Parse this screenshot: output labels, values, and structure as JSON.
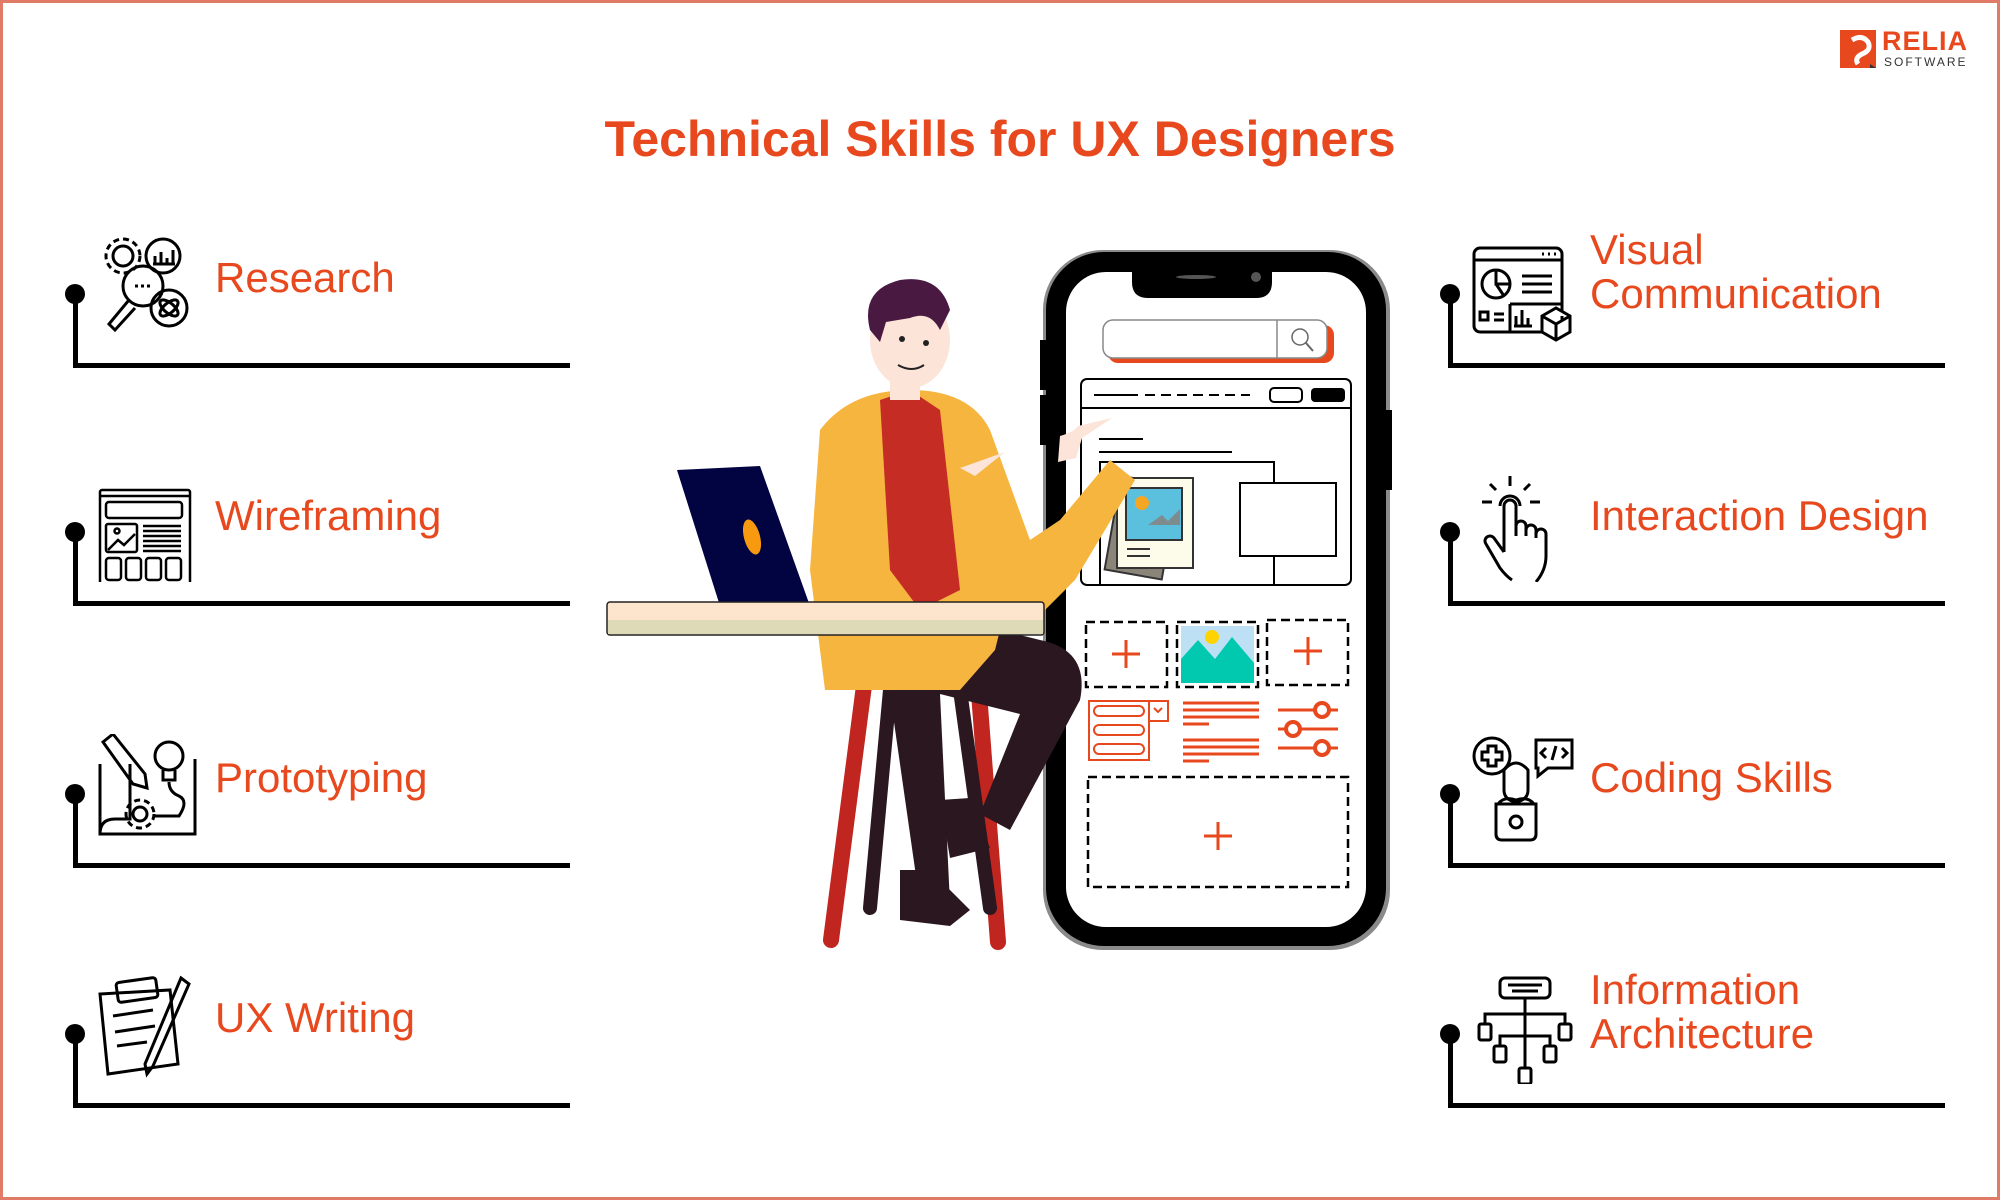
{
  "brand": {
    "name": "RELIA",
    "sub": "SOFTWARE",
    "accent": "#e8481e",
    "border": "#e07b68"
  },
  "title": "Technical Skills for UX Designers",
  "left_items": [
    {
      "label": "Research",
      "icon": "research-icon"
    },
    {
      "label": "Wireframing",
      "icon": "wireframe-icon"
    },
    {
      "label": "Prototyping",
      "icon": "prototype-icon"
    },
    {
      "label": "UX Writing",
      "icon": "writing-icon"
    }
  ],
  "right_items": [
    {
      "label_line1": "Visual",
      "label_line2": "Communication",
      "icon": "visual-communication-icon"
    },
    {
      "label": "Interaction Design",
      "icon": "tap-hand-icon"
    },
    {
      "label": "Coding Skills",
      "icon": "coding-icon"
    },
    {
      "label_line1": "Information",
      "label_line2": "Architecture",
      "icon": "sitemap-icon"
    }
  ]
}
